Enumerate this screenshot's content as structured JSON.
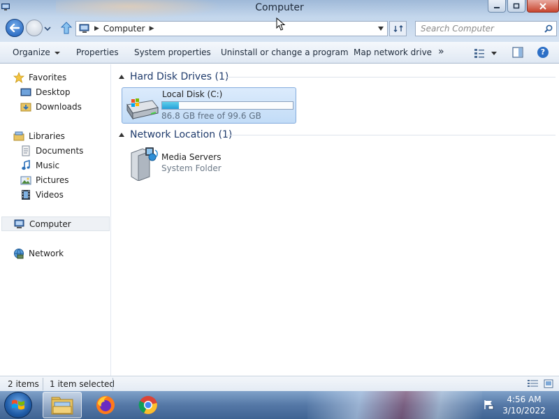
{
  "window": {
    "title": "Computer",
    "icon": "computer-icon"
  },
  "navigation": {
    "back_icon": "back-arrow-icon",
    "forward_icon": "forward-arrow-icon",
    "up_icon": "up-arrow-icon",
    "address_crumb": "Computer",
    "search_placeholder": "Search Computer"
  },
  "toolbar": {
    "organize": "Organize",
    "properties": "Properties",
    "system_properties": "System properties",
    "uninstall": "Uninstall or change a program",
    "map_drive": "Map network drive",
    "more": "»"
  },
  "sidebar": {
    "favorites": "Favorites",
    "desktop": "Desktop",
    "downloads": "Downloads",
    "libraries": "Libraries",
    "documents": "Documents",
    "music": "Music",
    "pictures": "Pictures",
    "videos": "Videos",
    "computer": "Computer",
    "network": "Network"
  },
  "content": {
    "groups": [
      {
        "title": "Hard Disk Drives (1)"
      },
      {
        "title": "Network Location (1)"
      }
    ],
    "drive": {
      "name": "Local Disk (C:)",
      "free_text": "86.8 GB free of 99.6 GB",
      "used_fraction": 0.129
    },
    "media": {
      "name": "Media Servers",
      "type": "System Folder"
    }
  },
  "status": {
    "count": "2 items",
    "selected": "1 item selected"
  },
  "taskbar": {
    "apps": [
      "file-explorer-icon",
      "firefox-icon",
      "chrome-icon"
    ],
    "time": "4:56 AM",
    "date": "3/10/2022"
  },
  "colors": {
    "accent": "#26a0da",
    "group_header": "#1e3a6b",
    "selection": "#c2dcf7"
  }
}
